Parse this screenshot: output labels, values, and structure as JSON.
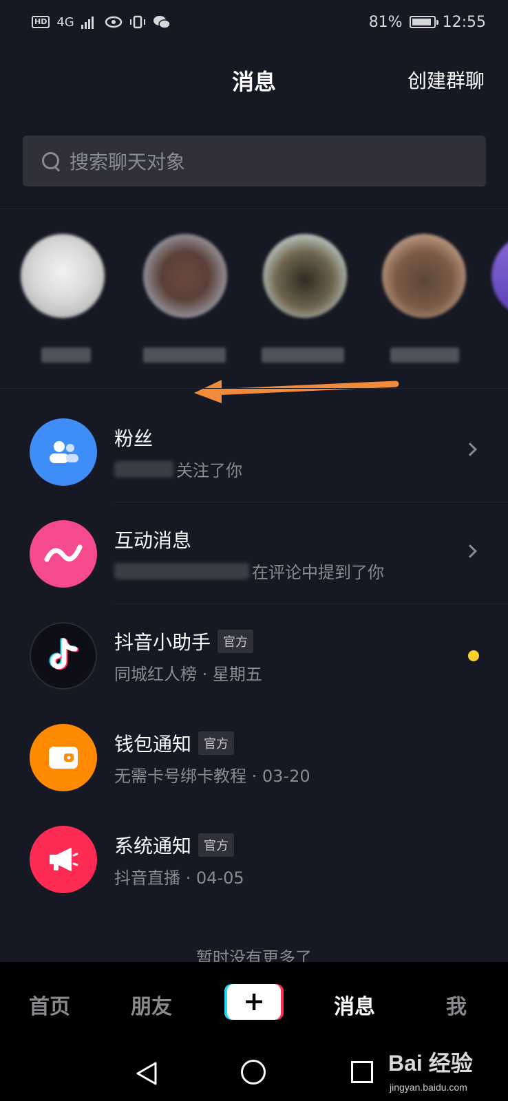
{
  "status_bar": {
    "network": "HD",
    "signal": "4G",
    "battery": "81%",
    "time": "12:55"
  },
  "header": {
    "title": "消息",
    "action": "创建群聊"
  },
  "search": {
    "placeholder": "搜索聊天对象"
  },
  "messages": [
    {
      "title": "粉丝",
      "subtitle": "关注了你",
      "icon": "fans-icon",
      "color": "#3f8ef7",
      "has_chevron": true
    },
    {
      "title": "互动消息",
      "subtitle": "在评论中提到了你",
      "icon": "interaction-icon",
      "color": "#f54a8f",
      "has_chevron": true
    },
    {
      "title": "抖音小助手",
      "badge": "官方",
      "subtitle": "同城红人榜 · 星期五",
      "icon": "tiktok-icon",
      "color": "#0e0f16",
      "unread": true
    },
    {
      "title": "钱包通知",
      "badge": "官方",
      "subtitle": "无需卡号绑卡教程 · 03-20",
      "icon": "wallet-icon",
      "color": "#ff8a00"
    },
    {
      "title": "系统通知",
      "badge": "官方",
      "subtitle": "抖音直播 · 04-05",
      "icon": "megaphone-icon",
      "color": "#fe2c55"
    }
  ],
  "footer_text": "暂时没有更多了",
  "bottom_nav": {
    "home": "首页",
    "friends": "朋友",
    "plus": "+",
    "messages": "消息",
    "me": "我",
    "active": "消息"
  },
  "watermark": {
    "brand": "Bai 经验",
    "url": "jingyan.baidu.com"
  },
  "colors": {
    "background": "#161823",
    "accent_yellow": "#fbd12b",
    "tiktok_cyan": "#20d5ec",
    "tiktok_red": "#fe2c55"
  }
}
